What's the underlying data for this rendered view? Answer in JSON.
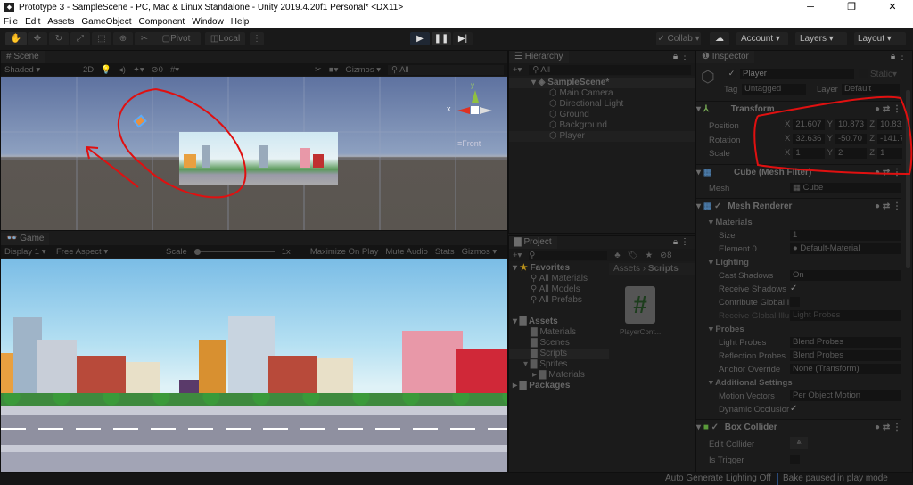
{
  "window": {
    "title": "Prototype 3 - SampleScene - PC, Mac & Linux Standalone - Unity 2019.4.20f1 Personal* <DX11>",
    "controls": [
      "─",
      "❐",
      "✕"
    ]
  },
  "menu": [
    "File",
    "Edit",
    "Assets",
    "GameObject",
    "Component",
    "Window",
    "Help"
  ],
  "toolbar": {
    "pivot": "Pivot",
    "local": "Local",
    "collab": "Collab",
    "account": "Account",
    "layers": "Layers",
    "layout": "Layout"
  },
  "scene": {
    "tab": "Scene",
    "shading": "Shaded",
    "mode2d": "2D",
    "hidden_count": "0",
    "gizmos": "Gizmos",
    "search_placeholder": "All",
    "persp": "≡Front",
    "axis_y": "y",
    "axis_x": "x"
  },
  "game": {
    "tab": "Game",
    "display": "Display 1",
    "aspect": "Free Aspect",
    "scale_label": "Scale",
    "scale_value": "1x",
    "maximize": "Maximize On Play",
    "mute": "Mute Audio",
    "stats": "Stats",
    "gizmos": "Gizmos",
    "scale_fraction": 0
  },
  "hierarchy": {
    "tab": "Hierarchy",
    "search_placeholder": "All",
    "scene": "SampleScene*",
    "items": [
      "Main Camera",
      "Directional Light",
      "Ground",
      "Background",
      "Player"
    ]
  },
  "project": {
    "tab": "Project",
    "hidden_count": "8",
    "favorites": "Favorites",
    "fav_items": [
      "All Materials",
      "All Models",
      "All Prefabs"
    ],
    "assets": "Assets",
    "asset_items": [
      "Materials",
      "Scenes",
      "Scripts"
    ],
    "sprites": "Sprites",
    "sprite_items": [
      "Materials"
    ],
    "packages": "Packages",
    "breadcrumb": [
      "Assets",
      "Scripts"
    ],
    "file": "PlayerCont..."
  },
  "inspector": {
    "tab": "Inspector",
    "name": "Player",
    "static": "Static",
    "tag_label": "Tag",
    "tag": "Untagged",
    "layer_label": "Layer",
    "layer": "Default",
    "transform": {
      "title": "Transform",
      "position_label": "Position",
      "rotation_label": "Rotation",
      "scale_label": "Scale",
      "position": [
        "21.607",
        "10.873",
        "10.831"
      ],
      "rotation": [
        "32.636",
        "-50.70",
        "-141.7"
      ],
      "scale": [
        "1",
        "2",
        "1"
      ]
    },
    "mesh_filter": {
      "title": "Cube (Mesh Filter)",
      "mesh_label": "Mesh",
      "mesh": "Cube"
    },
    "mesh_renderer": {
      "title": "Mesh Renderer",
      "materials": "Materials",
      "size_label": "Size",
      "size": "1",
      "element_label": "Element 0",
      "element": "Default-Material",
      "lighting": "Lighting",
      "cast_label": "Cast Shadows",
      "cast": "On",
      "receive_label": "Receive Shadows",
      "contribute_label": "Contribute Global I",
      "receive_gi_label": "Receive Global Illu",
      "receive_gi": "Light Probes",
      "probes": "Probes",
      "light_probes_label": "Light Probes",
      "light_probes": "Blend Probes",
      "refl_label": "Reflection Probes",
      "refl": "Blend Probes",
      "anchor_label": "Anchor Override",
      "anchor": "None (Transform)",
      "additional": "Additional Settings",
      "motion_label": "Motion Vectors",
      "motion": "Per Object Motion",
      "dyn_label": "Dynamic Occlusior"
    },
    "box_collider": {
      "title": "Box Collider",
      "edit_label": "Edit Collider",
      "trigger_label": "Is Trigger"
    }
  },
  "status": {
    "lighting": "Auto Generate Lighting Off",
    "bake": "Bake paused in play mode"
  },
  "colors": {
    "annotation": "#e01010",
    "accent_play": "#1f2733"
  }
}
